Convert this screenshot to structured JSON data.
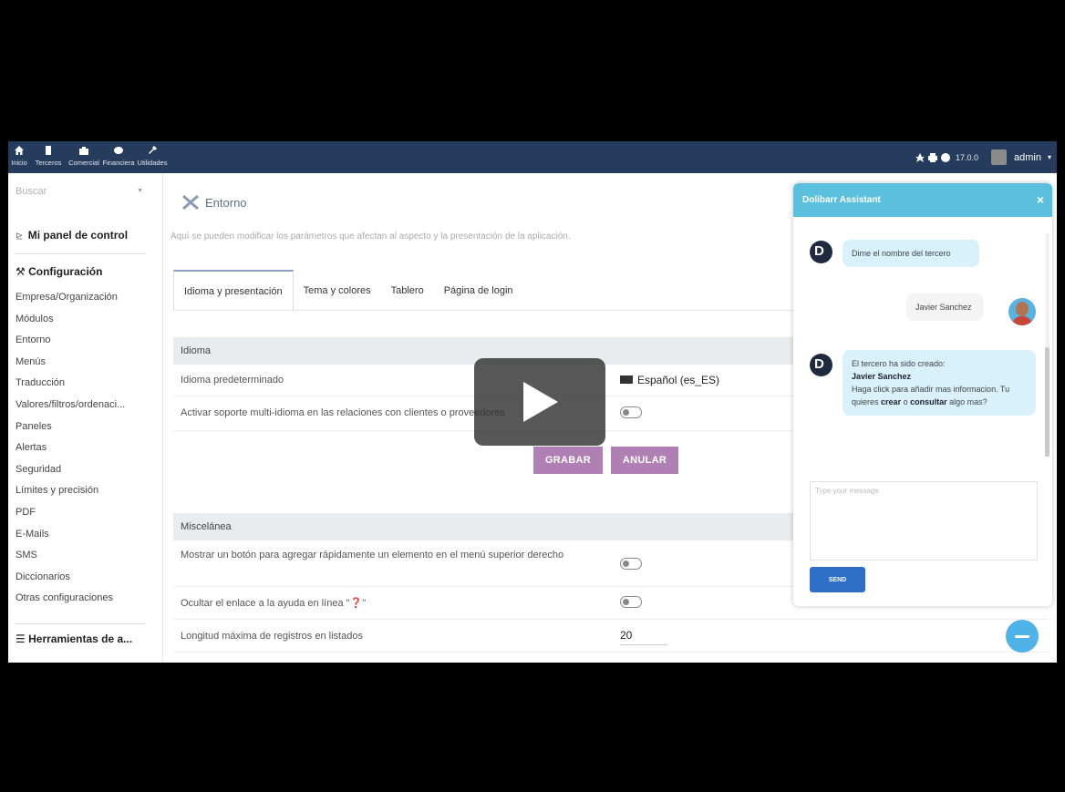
{
  "topbar": {
    "nav": [
      {
        "label": "Inicio",
        "icon": "home-icon"
      },
      {
        "label": "Terceros",
        "icon": "building-icon"
      },
      {
        "label": "Comercial",
        "icon": "briefcase-icon"
      },
      {
        "label": "Financiera",
        "icon": "money-icon"
      },
      {
        "label": "Utilidades",
        "icon": "wrench-icon"
      }
    ],
    "version": "17.0.0",
    "user": "admin"
  },
  "sidebar": {
    "search_placeholder": "Buscar",
    "panel_link": "Mi panel de control",
    "config_title": "Configuración",
    "items": [
      "Empresa/Organización",
      "Módulos",
      "Entorno",
      "Menús",
      "Traducción",
      "Valores/filtros/ordenaci...",
      "Paneles",
      "Alertas",
      "Seguridad",
      "Límites y precisión",
      "PDF",
      "E-Mails",
      "SMS",
      "Diccionarios",
      "Otras configuraciones"
    ],
    "tools_title": "Herramientas de a..."
  },
  "main": {
    "title": "Entorno",
    "description": "Aquí se pueden modificar los parámetros que afectan al aspecto y la presentación de la aplicación.",
    "tabs": [
      "Idioma y presentación",
      "Tema y colores",
      "Tablero",
      "Página de login"
    ],
    "idioma": {
      "header": "Idioma",
      "default_language_label": "Idioma predeterminado",
      "default_language_value": "Español (es_ES)",
      "multilang_label": "Activar soporte multi-idioma en las relaciones con clientes o proveedores"
    },
    "buttons": {
      "save": "GRABAR",
      "cancel": "ANULAR"
    },
    "misc": {
      "header": "Miscelánea",
      "quick_add_label": "Mostrar un botón para agregar rápidamente un elemento en el menú superior derecho",
      "hide_help_label": "Ocultar el enlace a la ayuda en línea \"❓\"",
      "max_records_label": "Longitud máxima de registros en listados",
      "max_records_value": "20"
    }
  },
  "chat": {
    "title": "Dolibarr Assistant",
    "messages": {
      "bot1": "Dime el nombre del tercero",
      "user1": "Javier Sanchez",
      "bot2_line1": "El tercero ha sido creado:",
      "bot2_name": "Javier Sanchez",
      "bot2_line2": "Haga click para añadir mas informacion. Tu quieres",
      "bot2_create": "crear",
      "bot2_or": "o",
      "bot2_consult": "consultar",
      "bot2_end": "algo mas?"
    },
    "input_placeholder": "Type your message",
    "send_label": "SEND"
  }
}
